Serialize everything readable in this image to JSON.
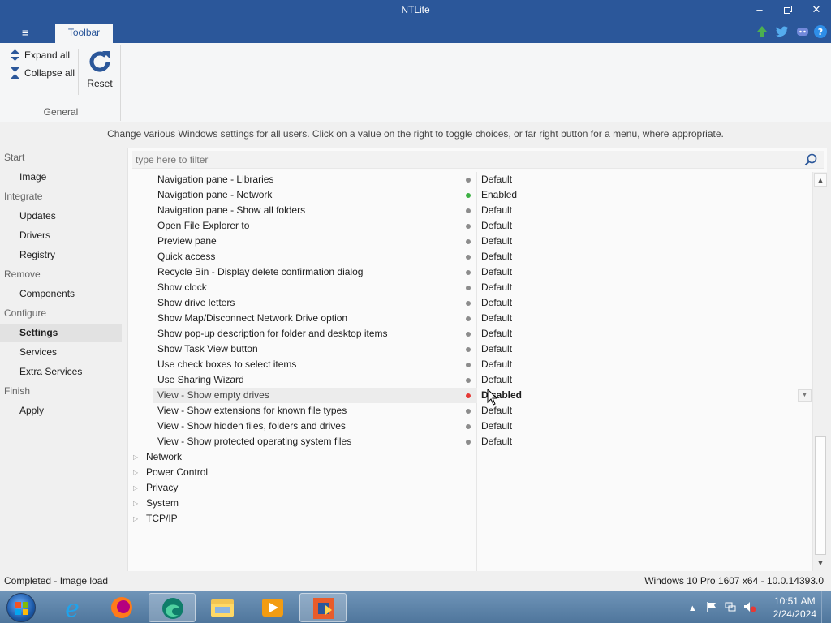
{
  "window": {
    "title": "NTLite"
  },
  "ribbon": {
    "tab": "Toolbar",
    "expand_all": "Expand all",
    "collapse_all": "Collapse all",
    "reset": "Reset",
    "group_label": "General"
  },
  "description": "Change various Windows settings for all users. Click on a value on the right to toggle choices, or far right button for a menu, where appropriate.",
  "sidebar": {
    "items": [
      {
        "label": "Start",
        "kind": "section"
      },
      {
        "label": "Image",
        "kind": "sub"
      },
      {
        "label": "Integrate",
        "kind": "section"
      },
      {
        "label": "Updates",
        "kind": "sub"
      },
      {
        "label": "Drivers",
        "kind": "sub"
      },
      {
        "label": "Registry",
        "kind": "sub"
      },
      {
        "label": "Remove",
        "kind": "section"
      },
      {
        "label": "Components",
        "kind": "sub"
      },
      {
        "label": "Configure",
        "kind": "section"
      },
      {
        "label": "Settings",
        "kind": "sub",
        "active": true
      },
      {
        "label": "Services",
        "kind": "sub"
      },
      {
        "label": "Extra Services",
        "kind": "sub"
      },
      {
        "label": "Finish",
        "kind": "section"
      },
      {
        "label": "Apply",
        "kind": "sub"
      }
    ]
  },
  "filter": {
    "placeholder": "type here to filter"
  },
  "settings": {
    "rows": [
      {
        "label": "Navigation pane - Libraries",
        "value": "Default",
        "status": "default"
      },
      {
        "label": "Navigation pane - Network",
        "value": "Enabled",
        "status": "enabled"
      },
      {
        "label": "Navigation pane - Show all folders",
        "value": "Default",
        "status": "default"
      },
      {
        "label": "Open File Explorer to",
        "value": "Default",
        "status": "default"
      },
      {
        "label": "Preview pane",
        "value": "Default",
        "status": "default"
      },
      {
        "label": "Quick access",
        "value": "Default",
        "status": "default"
      },
      {
        "label": "Recycle Bin - Display delete confirmation dialog",
        "value": "Default",
        "status": "default"
      },
      {
        "label": "Show clock",
        "value": "Default",
        "status": "default"
      },
      {
        "label": "Show drive letters",
        "value": "Default",
        "status": "default"
      },
      {
        "label": "Show Map/Disconnect Network Drive option",
        "value": "Default",
        "status": "default"
      },
      {
        "label": "Show pop-up description for folder and desktop items",
        "value": "Default",
        "status": "default"
      },
      {
        "label": "Show Task View button",
        "value": "Default",
        "status": "default"
      },
      {
        "label": "Use check boxes to select items",
        "value": "Default",
        "status": "default"
      },
      {
        "label": "Use Sharing Wizard",
        "value": "Default",
        "status": "default"
      },
      {
        "label": "View - Show empty drives",
        "value": "Disabled",
        "status": "disabled",
        "selected": true
      },
      {
        "label": "View - Show extensions for known file types",
        "value": "Default",
        "status": "default"
      },
      {
        "label": "View - Show hidden files, folders and drives",
        "value": "Default",
        "status": "default"
      },
      {
        "label": "View - Show protected operating system files",
        "value": "Default",
        "status": "default"
      }
    ],
    "groups": [
      "Network",
      "Power Control",
      "Privacy",
      "System",
      "TCP/IP"
    ]
  },
  "colors": {
    "default": "#8c8c8c",
    "enabled": "#3cb043",
    "disabled": "#e53935",
    "accent": "#2b579a"
  },
  "statusbar": {
    "left": "Completed - Image load",
    "right": "Windows 10 Pro 1607 x64 - 10.0.14393.0"
  },
  "taskbar": {
    "apps": [
      "internet-explorer-icon",
      "firefox-icon",
      "edge-icon",
      "file-explorer-icon",
      "media-player-icon",
      "ntlite-icon"
    ],
    "clock_time": "10:51 AM",
    "clock_date": "2/24/2024"
  }
}
